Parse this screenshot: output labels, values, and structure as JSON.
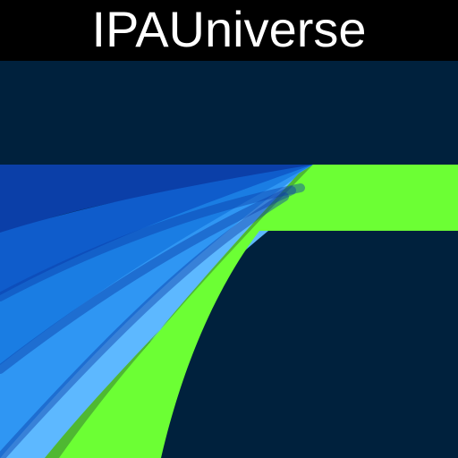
{
  "banner": {
    "text": "IPAUniverse"
  },
  "artwork": {
    "icon": "lumafusion-app-logo-icon",
    "colors": {
      "background": "#00213D",
      "green": "#6CFF34",
      "green_shadow": "#4FB832",
      "blue_light": "#5DB8FF",
      "blue_mid": "#2F96F3",
      "blue_mid_2": "#1A7DE3",
      "blue_dark": "#0F5CCB",
      "blue_deep": "#0B3FA8"
    }
  }
}
